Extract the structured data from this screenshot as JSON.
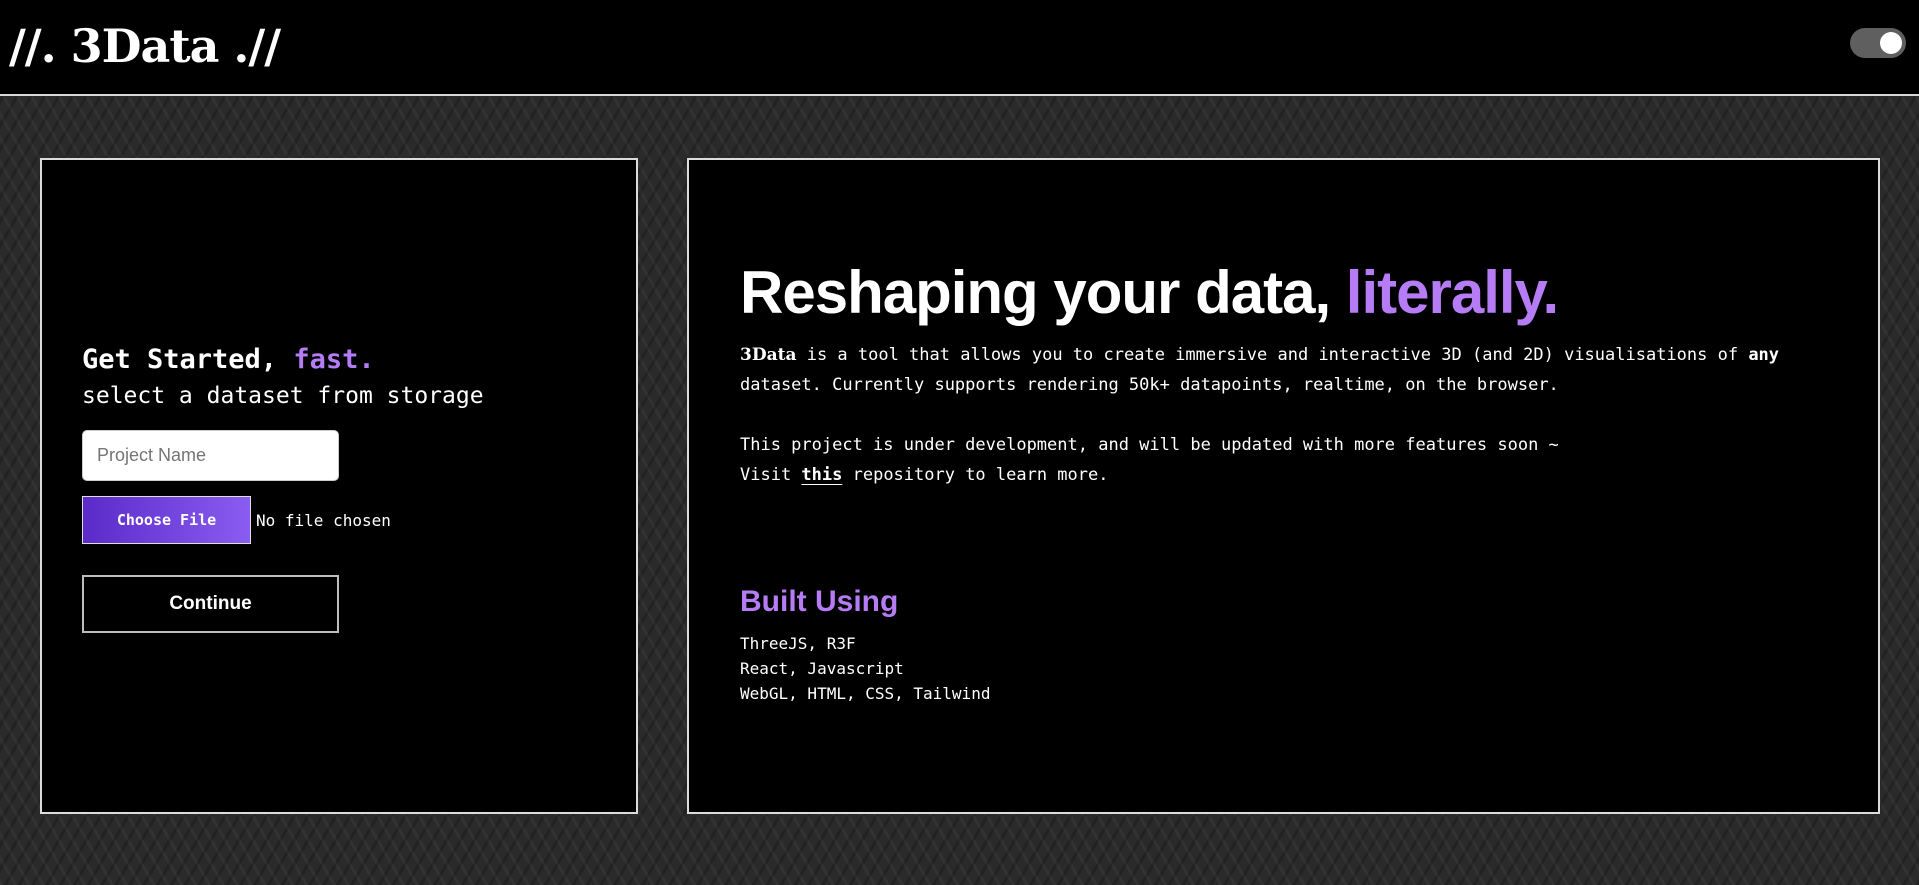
{
  "header": {
    "logo": "//. 3Data .//",
    "theme_toggle": {
      "state": "on"
    }
  },
  "colors": {
    "accent": "#b57cf5",
    "button_gradient_start": "#5b2bc9",
    "button_gradient_end": "#8a5cf0",
    "panel_border": "#dcdcdc",
    "background_pattern": "#2a2a2a"
  },
  "get_started": {
    "heading": "Get Started,",
    "heading_accent": "fast.",
    "subheading": "select a dataset from storage",
    "project_name_placeholder": "Project Name",
    "project_name_value": "",
    "file_button_label": "Choose File",
    "file_status": "No file chosen",
    "continue_label": "Continue"
  },
  "hero": {
    "title": "Reshaping your data,",
    "title_accent": "literally.",
    "brand_name": "3Data",
    "description_part1": " is a tool that allows you to create immersive and interactive 3D (and 2D) visualisations of ",
    "description_emphasis": "any",
    "description_part2": " dataset. Currently supports rendering 50k+ datapoints, realtime, on the browser.",
    "dev_note": "This project is under development, and will be updated with more features soon ~",
    "visit_prefix": "Visit ",
    "visit_link": "this",
    "visit_suffix": " repository to learn more."
  },
  "built_using": {
    "heading": "Built Using",
    "items": [
      "ThreeJS, R3F",
      "React, Javascript",
      "WebGL, HTML, CSS, Tailwind"
    ]
  }
}
